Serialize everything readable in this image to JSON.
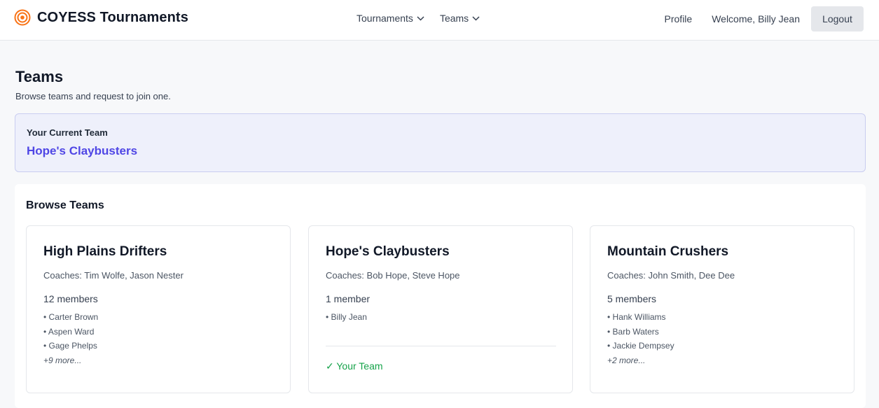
{
  "header": {
    "brand": "COYESS Tournaments",
    "nav": [
      {
        "label": "Tournaments"
      },
      {
        "label": "Teams"
      }
    ],
    "profile_label": "Profile",
    "welcome_text": "Welcome, Billy Jean",
    "logout_label": "Logout",
    "brand_color": "#f97316"
  },
  "page": {
    "title": "Teams",
    "subtitle": "Browse teams and request to join one."
  },
  "current_team": {
    "label": "Your Current Team",
    "name": "Hope's Claybusters"
  },
  "browse": {
    "title": "Browse Teams",
    "teams": [
      {
        "name": "High Plains Drifters",
        "coaches": "Coaches: Tim Wolfe, Jason Nester",
        "members_count": "12 members",
        "members": [
          "• Carter Brown",
          "• Aspen Ward",
          "• Gage Phelps"
        ],
        "more": "+9 more..."
      },
      {
        "name": "Hope's Claybusters",
        "coaches": "Coaches: Bob Hope, Steve Hope",
        "members_count": "1 member",
        "members": [
          "• Billy Jean"
        ],
        "status": "✓ Your Team"
      },
      {
        "name": "Mountain Crushers",
        "coaches": "Coaches: John Smith, Dee Dee",
        "members_count": "5 members",
        "members": [
          "• Hank Williams",
          "• Barb Waters",
          "• Jackie Dempsey"
        ],
        "more": "+2 more..."
      }
    ]
  }
}
